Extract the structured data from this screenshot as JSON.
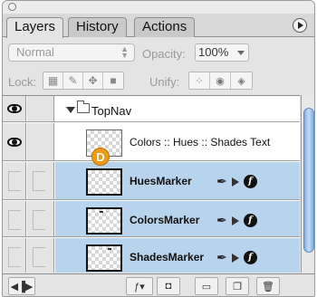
{
  "tabs": [
    "Layers",
    "History",
    "Actions"
  ],
  "blend_mode": "Normal",
  "opacity": {
    "label": "Opacity:",
    "value": "100%"
  },
  "lock": {
    "label": "Lock:"
  },
  "unify": {
    "label": "Unify:"
  },
  "layers": [
    {
      "name": "TopNav",
      "type": "folder",
      "visible": true
    },
    {
      "name": "Colors :: Hues :: Shades Text",
      "type": "layer",
      "visible": true
    },
    {
      "name": "HuesMarker",
      "type": "layer",
      "visible": false,
      "selected": true
    },
    {
      "name": "ColorsMarker",
      "type": "layer",
      "visible": false,
      "selected": true
    },
    {
      "name": "ShadesMarker",
      "type": "layer",
      "visible": false,
      "selected": true
    }
  ],
  "badge": "D",
  "colors": {
    "selection": "#b8d3ec",
    "badge": "#f09a1a",
    "scroll_thumb": "#7eaee0"
  }
}
